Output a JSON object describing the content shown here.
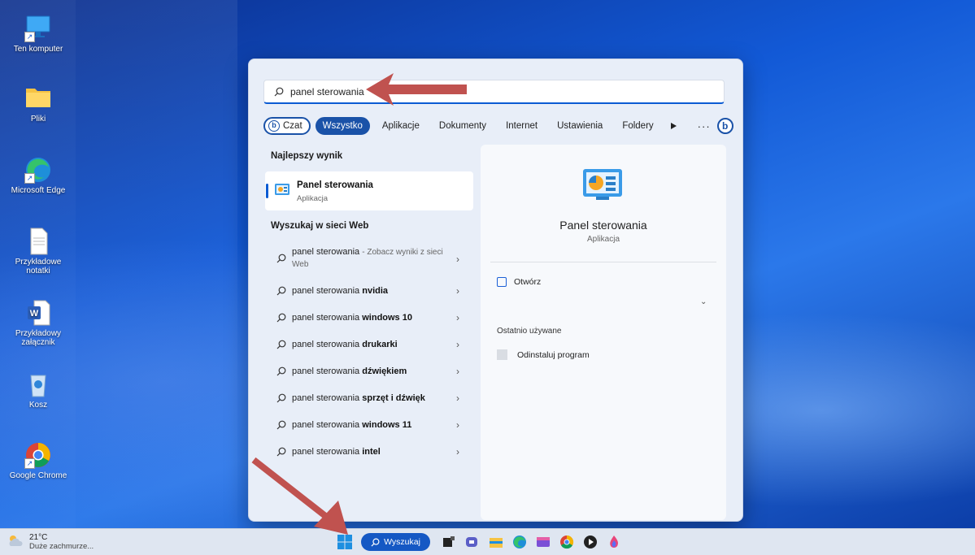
{
  "desktop": {
    "icons": [
      {
        "label": "Ten komputer",
        "icon": "monitor-icon"
      },
      {
        "label": "Pliki",
        "icon": "folder-icon"
      },
      {
        "label": "Microsoft Edge",
        "icon": "edge-icon"
      },
      {
        "label": "Przykładowe notatki",
        "icon": "document-icon"
      },
      {
        "label": "Przykładowy załącznik",
        "icon": "word-document-icon"
      },
      {
        "label": "Kosz",
        "icon": "recycle-bin-icon"
      },
      {
        "label": "Google Chrome",
        "icon": "chrome-icon"
      }
    ]
  },
  "search": {
    "query": "panel sterowania"
  },
  "filters": {
    "chat": "Czat",
    "items": [
      "Wszystko",
      "Aplikacje",
      "Dokumenty",
      "Internet",
      "Ustawienia",
      "Foldery"
    ],
    "active": "Wszystko",
    "more": "···"
  },
  "results": {
    "best_title": "Najlepszy wynik",
    "best": {
      "name": "Panel sterowania",
      "type": "Aplikacja"
    },
    "web_title": "Wyszukaj w sieci Web",
    "web": [
      {
        "prefix": "panel sterowania",
        "bold": "",
        "hint": "- Zobacz wyniki z sieci Web"
      },
      {
        "prefix": "panel sterowania ",
        "bold": "nvidia",
        "hint": ""
      },
      {
        "prefix": "panel sterowania ",
        "bold": "windows 10",
        "hint": ""
      },
      {
        "prefix": "panel sterowania ",
        "bold": "drukarki",
        "hint": ""
      },
      {
        "prefix": "panel sterowania ",
        "bold": "dźwiękiem",
        "hint": ""
      },
      {
        "prefix": "panel sterowania ",
        "bold": "sprzęt i dźwięk",
        "hint": ""
      },
      {
        "prefix": "panel sterowania ",
        "bold": "windows 11",
        "hint": ""
      },
      {
        "prefix": "panel sterowania ",
        "bold": "intel",
        "hint": ""
      }
    ]
  },
  "details": {
    "name": "Panel sterowania",
    "type": "Aplikacja",
    "open": "Otwórz",
    "recent_title": "Ostatnio używane",
    "recent": [
      "Odinstaluj program"
    ]
  },
  "taskbar": {
    "temperature": "21°C",
    "weather": "Duże zachmurze...",
    "search_label": "Wyszukaj"
  },
  "colors": {
    "accent": "#1a52a8",
    "arrow": "#c0524f"
  }
}
